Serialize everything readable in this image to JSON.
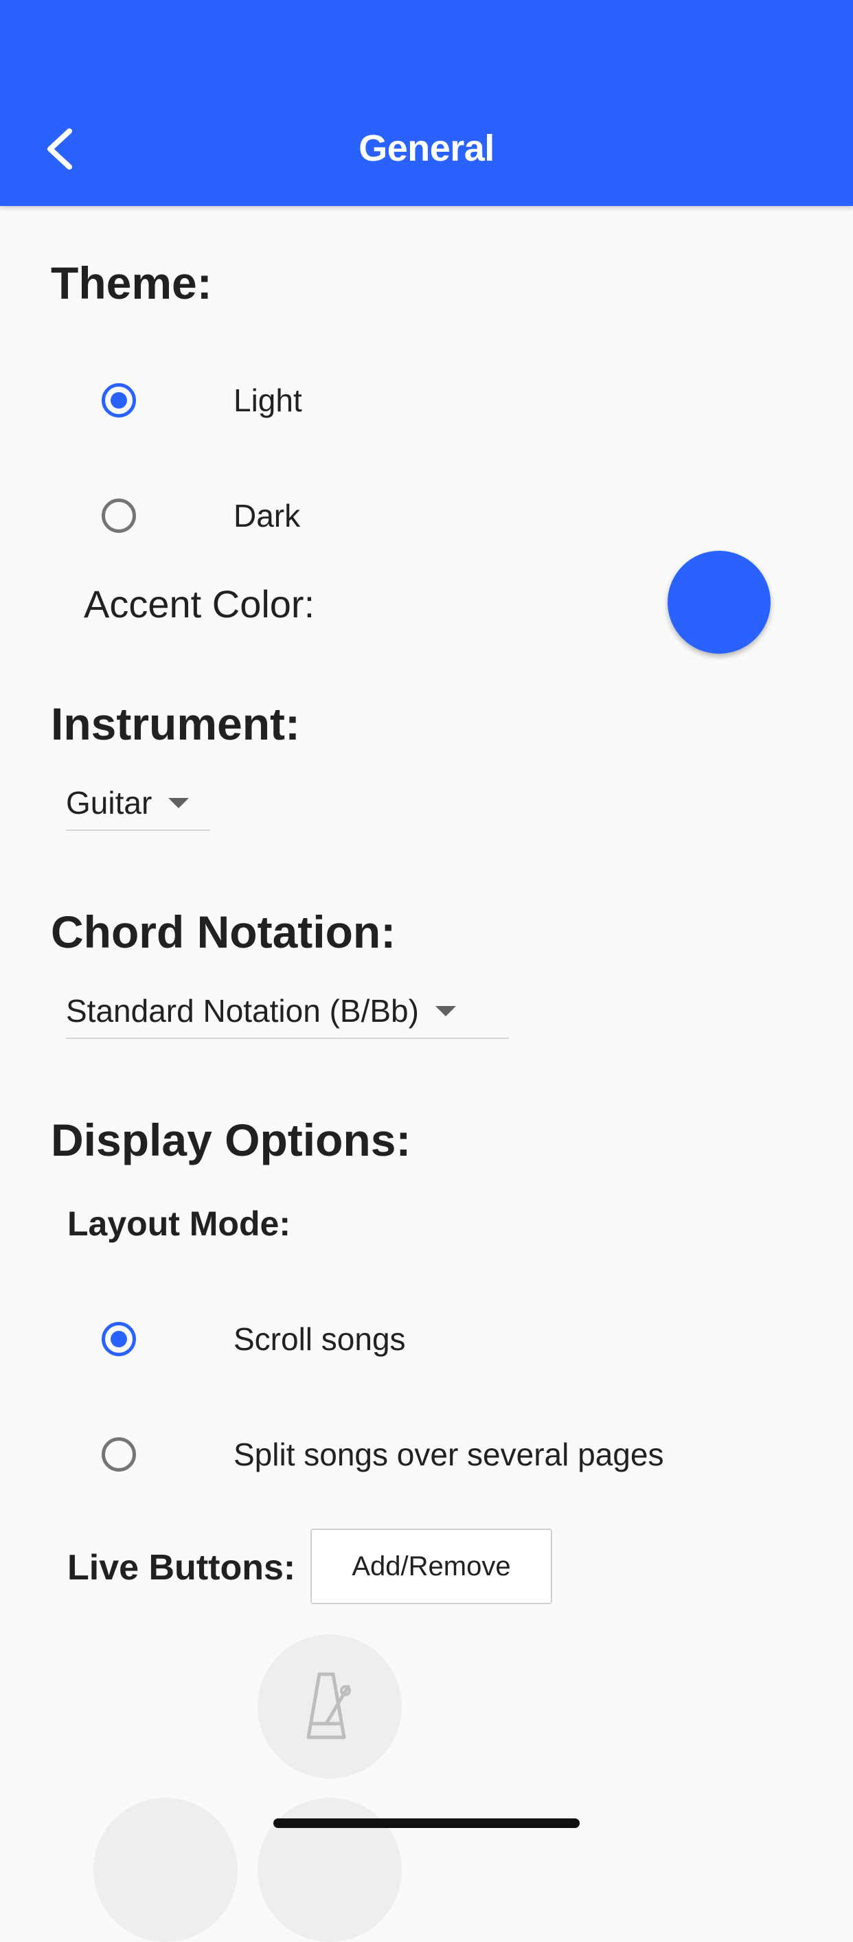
{
  "header": {
    "title": "General"
  },
  "theme": {
    "title": "Theme:",
    "options": [
      {
        "label": "Light",
        "selected": true
      },
      {
        "label": "Dark",
        "selected": false
      }
    ],
    "accent_label": "Accent Color:",
    "accent_color": "#2962ff"
  },
  "instrument": {
    "title": "Instrument:",
    "value": "Guitar"
  },
  "chord_notation": {
    "title": "Chord Notation:",
    "value": "Standard Notation (B/Bb)"
  },
  "display_options": {
    "title": "Display Options:",
    "layout_mode": {
      "title": "Layout Mode:",
      "options": [
        {
          "label": "Scroll songs",
          "selected": true
        },
        {
          "label": "Split songs over several pages",
          "selected": false
        }
      ]
    },
    "live_buttons": {
      "title": "Live Buttons:",
      "button_label": "Add/Remove",
      "icons": [
        "metronome-icon",
        "live-button-icon",
        "live-button-icon"
      ]
    }
  },
  "colors": {
    "header_bg": "#2962ff",
    "accent": "#2962ff",
    "background": "#fafafa"
  }
}
